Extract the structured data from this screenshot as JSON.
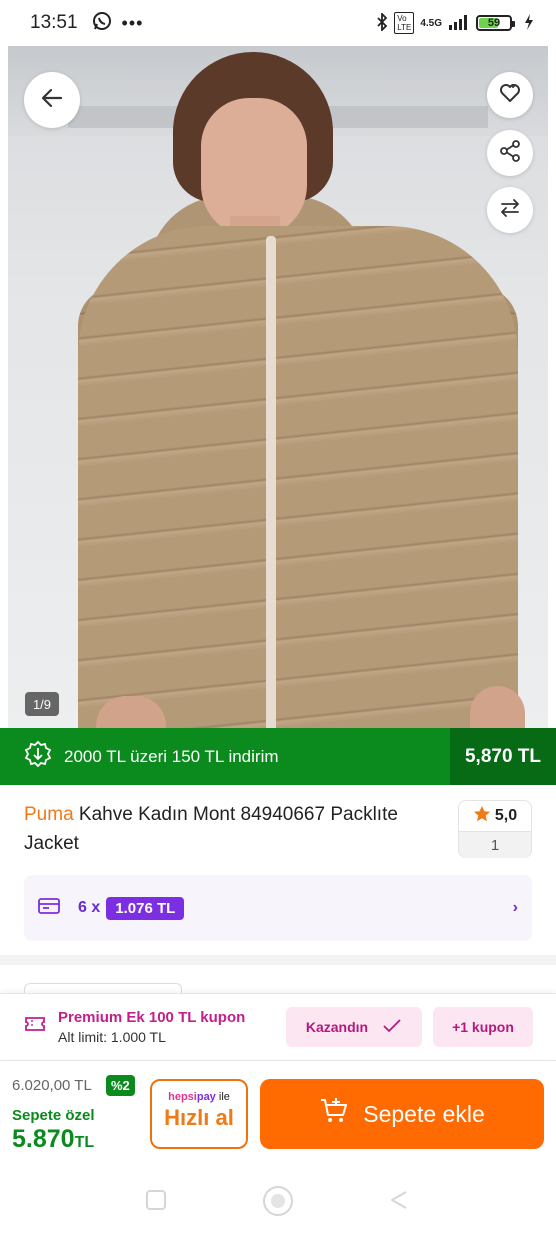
{
  "status_bar": {
    "time": "13:51",
    "network": "4.5G",
    "battery": "59",
    "battery_level": 0.59
  },
  "gallery": {
    "counter": "1/9"
  },
  "discount_banner": {
    "text": "2000 TL üzeri 150 TL indirim",
    "price": "5,870 TL",
    "color": "#0b8a1e"
  },
  "product": {
    "brand": "Puma",
    "name": "Kahve Kadın Mont 84940667 Packlıte Jacket",
    "rating": "5,0",
    "review_count": "1"
  },
  "installment": {
    "count": "6 x",
    "amount": "1.076 TL"
  },
  "coupon": {
    "title": "Premium Ek 100 TL kupon",
    "subtitle": "Alt limit: 1.000 TL",
    "won_label": "Kazandın",
    "more_label": "+1 kupon"
  },
  "purchase": {
    "old_price": "6.020,00 TL",
    "discount_pct": "%2",
    "special_label": "Sepete özel",
    "special_price": "5.870",
    "currency": "TL",
    "pay_brand_1": "hepsi",
    "pay_brand_2": "pay",
    "pay_suffix": " ile",
    "quick_buy": "Hızlı al",
    "add_to_cart": "Sepete ekle",
    "accent": "#ff6b00"
  }
}
